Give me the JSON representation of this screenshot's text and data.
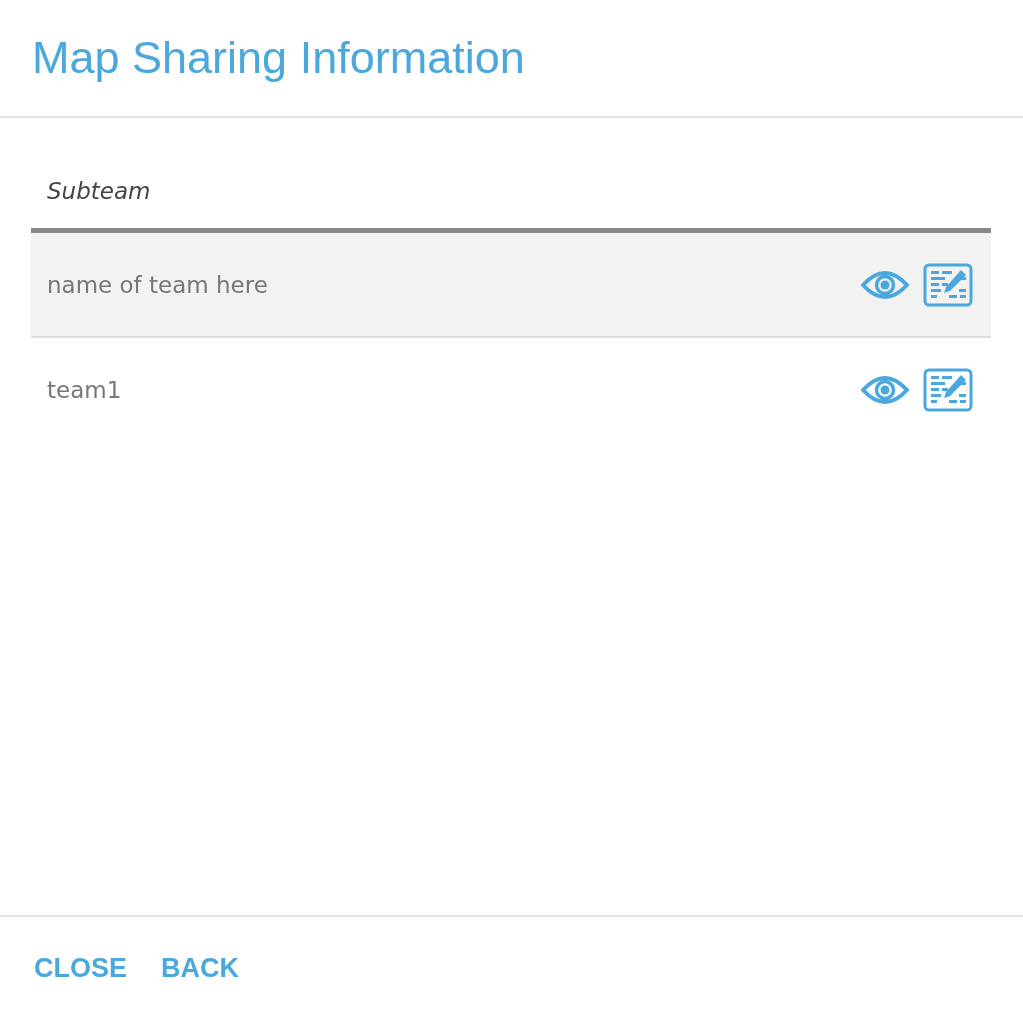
{
  "dialog": {
    "title": "Map Sharing Information"
  },
  "table": {
    "columns": [
      "Subteam"
    ],
    "rows": [
      {
        "name": "name of team here",
        "highlighted": true
      },
      {
        "name": "team1",
        "highlighted": false
      }
    ]
  },
  "buttons": [
    "CLOSE",
    "BACK"
  ]
}
